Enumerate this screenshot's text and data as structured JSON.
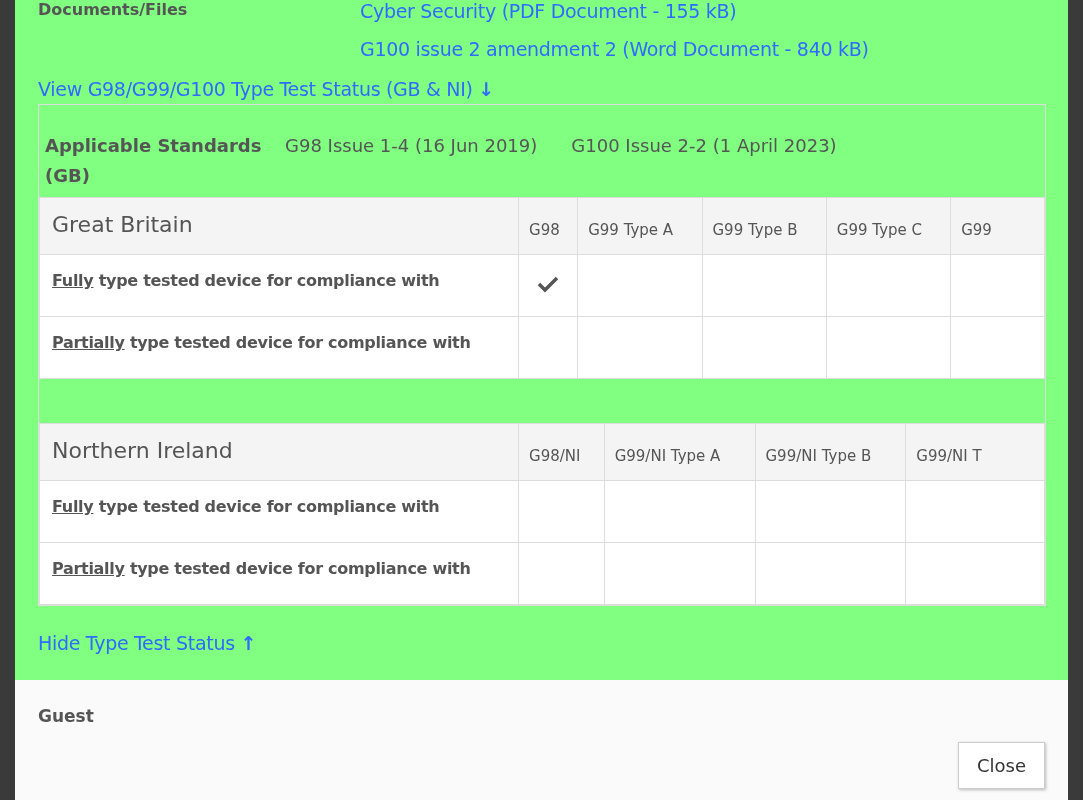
{
  "documents": {
    "label": "Documents/Files",
    "files": [
      "Cyber Security (PDF Document - 155 kB)",
      "G100 issue 2 amendment 2 (Word Document - 840 kB)"
    ]
  },
  "view_link": {
    "label": "View G98/G99/G100 Type Test Status (GB & NI)",
    "arrow": "↓"
  },
  "standards": {
    "label": "Applicable Standards (GB)",
    "items": [
      "G98 Issue 1-4 (16 Jun 2019)",
      "G100 Issue 2-2 (1 April 2023)"
    ]
  },
  "regions": [
    {
      "title": "Great Britain",
      "columns": [
        "G98",
        "G99 Type A",
        "G99 Type B",
        "G99 Type C",
        "G99"
      ],
      "rows": [
        {
          "emphasis": "Fully",
          "label": "type tested device for compliance with",
          "cells": [
            {
              "checked": true
            },
            {
              "checked": false
            },
            {
              "checked": false
            },
            {
              "checked": false
            },
            {
              "checked": false
            }
          ]
        },
        {
          "emphasis": "Partially",
          "label": "type tested device for compliance with",
          "cells": [
            {
              "checked": false
            },
            {
              "checked": false
            },
            {
              "checked": false
            },
            {
              "checked": false
            },
            {
              "checked": false
            }
          ]
        }
      ]
    },
    {
      "title": "Northern Ireland",
      "columns": [
        "G98/NI",
        "G99/NI Type A",
        "G99/NI Type B",
        "G99/NI T"
      ],
      "rows": [
        {
          "emphasis": "Fully",
          "label": "type tested device for compliance with",
          "cells": [
            {
              "checked": false
            },
            {
              "checked": false
            },
            {
              "checked": false
            },
            {
              "checked": false
            }
          ]
        },
        {
          "emphasis": "Partially",
          "label": "type tested device for compliance with",
          "cells": [
            {
              "checked": false
            },
            {
              "checked": false
            },
            {
              "checked": false
            },
            {
              "checked": false
            }
          ]
        }
      ]
    }
  ],
  "hide_link": {
    "label": "Hide Type Test Status",
    "arrow": "↑"
  },
  "footer": {
    "user": "Guest",
    "button": "Close"
  }
}
